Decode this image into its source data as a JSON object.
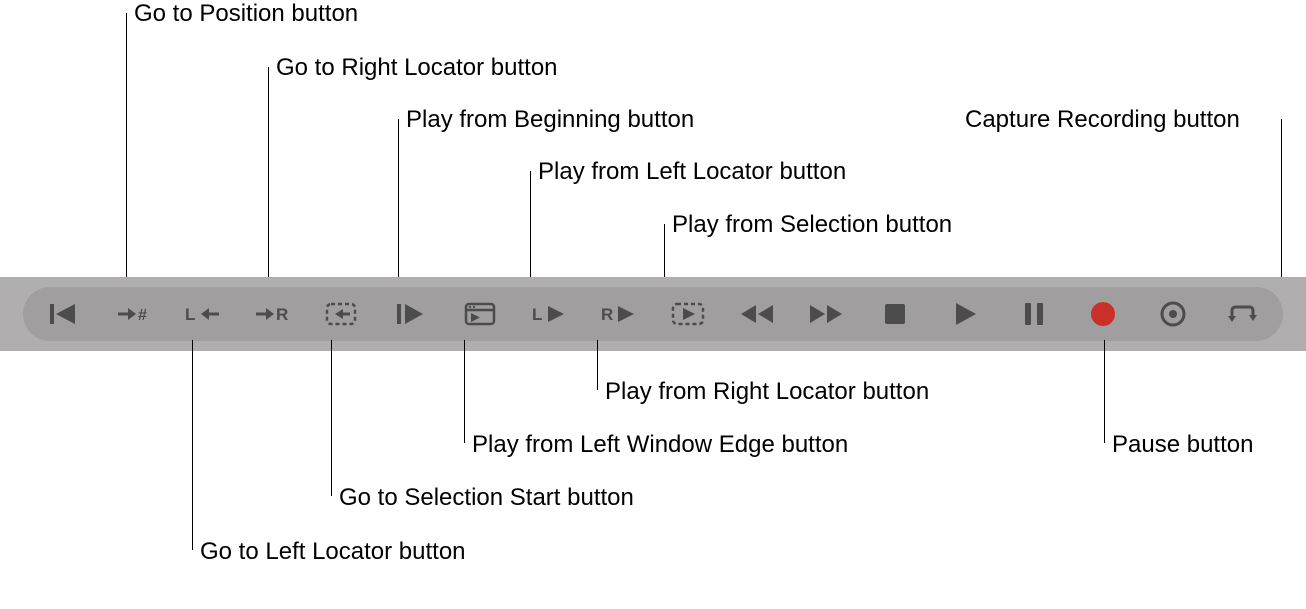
{
  "labels": {
    "goToPosition": "Go to Position button",
    "goToRightLocator": "Go to Right Locator button",
    "playFromBeginning": "Play from Beginning button",
    "playFromLeftLocator": "Play from Left Locator button",
    "playFromSelection": "Play from Selection button",
    "captureRecording": "Capture Recording button",
    "playFromRightLocator": "Play from Right Locator button",
    "playFromLeftWindowEdge": "Play from Left Window Edge button",
    "goToSelectionStart": "Go to Selection Start button",
    "goToLeftLocator": "Go to Left Locator button",
    "pause": "Pause button"
  },
  "colors": {
    "icon": "#4d4c4c",
    "record": "#c93029",
    "stripOuter": "#b0aeae",
    "stripInner": "#a09e9e"
  }
}
